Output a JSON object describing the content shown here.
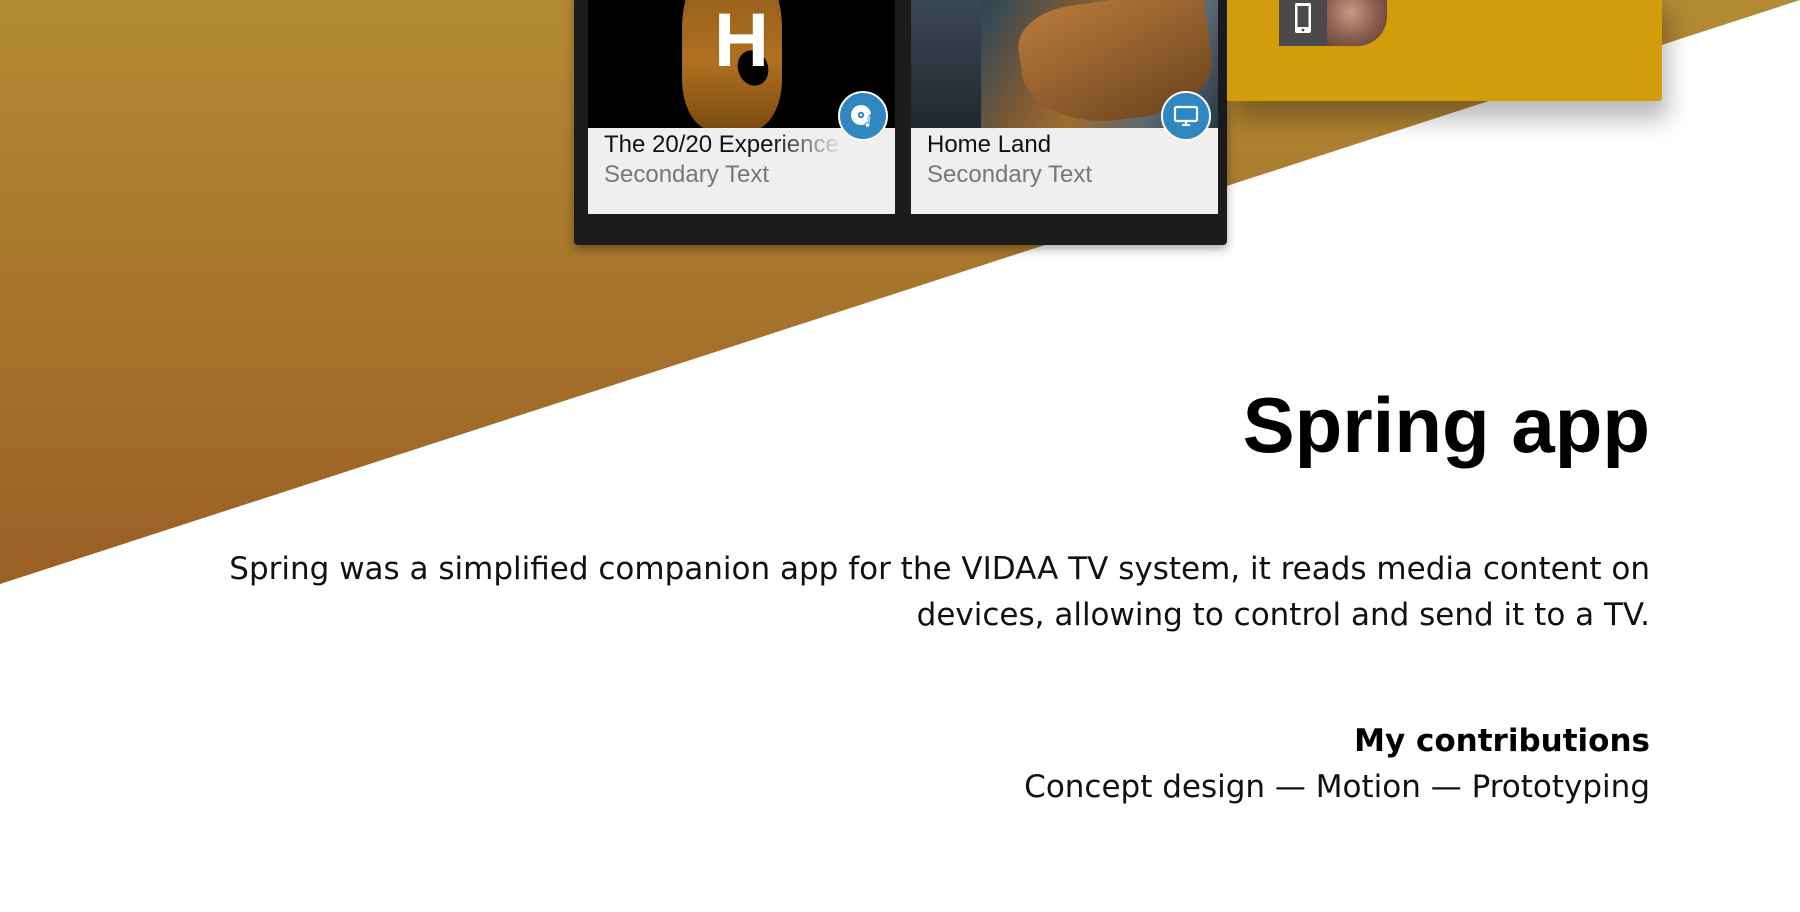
{
  "background": {
    "gradient_top": "#b38b34",
    "gradient_bottom": "#9a5f24",
    "base": "#ffffff"
  },
  "cards": [
    {
      "thumb_letter": "H",
      "title": "The 20/20 Experience",
      "subtitle": "Secondary Text",
      "badge_icon": "music-disc-icon"
    },
    {
      "thumb_letter": "",
      "title": "Home Land",
      "subtitle": "Secondary Text",
      "badge_icon": "tv-icon"
    }
  ],
  "device_panel": {
    "color": "#d19d0a",
    "device_icon": "phone-icon"
  },
  "badge_color": "#2f87c2",
  "content": {
    "title": "Spring app",
    "description": "Spring was a simplified companion app for the VIDAA TV system, it reads media content on devices, allowing to control and send it to a TV.",
    "contributions_heading": "My contributions",
    "contributions_list": "Concept design — Motion —  Prototyping"
  }
}
